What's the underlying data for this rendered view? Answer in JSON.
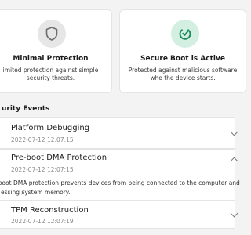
{
  "colors": {
    "background": "#f3f3f3",
    "card": "#ffffff",
    "accent_green": "#1a8a5a",
    "muted": "#8a8a8a"
  },
  "cards": [
    {
      "title": "Minimal Protection",
      "description": "imited protection against simple security threats.",
      "icon": "shield-icon"
    },
    {
      "title": "Secure Boot is Active",
      "description": "Protected against malicious software whe the device starts.",
      "icon": "power-check-icon"
    }
  ],
  "events_section": {
    "title": "urity Events",
    "items": [
      {
        "title": "Platform Debugging",
        "time": "2022-07-12 12:07:15"
      },
      {
        "title": "Pre-boot DMA Protection",
        "time": "2022-07-12 12:07:15",
        "description_lines": [
          "-boot DMA protection prevents devices from being connected to the computer and",
          "essing system memory."
        ]
      },
      {
        "title": "TPM Reconstruction",
        "time": "2022-07-12 12:07:19"
      }
    ]
  }
}
